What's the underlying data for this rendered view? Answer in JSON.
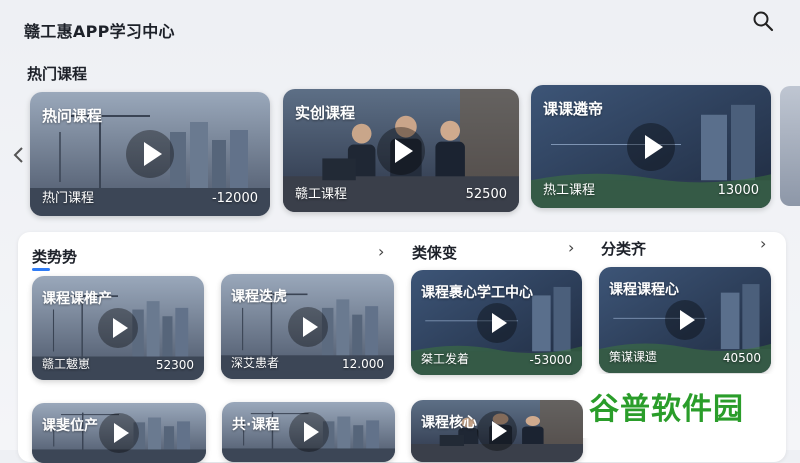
{
  "header": {
    "app_title": "赣工惠APP学习中心",
    "search_icon": "search-icon"
  },
  "hot": {
    "title": "热门课程",
    "cards": [
      {
        "title": "热问课程",
        "tag": "热门课程",
        "num": "-12000",
        "scene": "construction"
      },
      {
        "title": "实创课程",
        "tag": "赣工课程",
        "num": "52500",
        "scene": "classroom"
      },
      {
        "title": "课课遴帝",
        "tag": "热工课程",
        "num": "13000",
        "scene": "presentation"
      }
    ]
  },
  "categories": [
    {
      "title": "类势势",
      "cards": [
        {
          "title": "课程课椎产",
          "tag": "赣工魃崽",
          "num": "52300",
          "scene": "construction"
        },
        {
          "title": "课斐位产",
          "tag": "",
          "num": "",
          "scene": "construction"
        }
      ]
    },
    {
      "title": "",
      "cards": [
        {
          "title": "课程迭虎",
          "tag": "深艾患者",
          "num": "12.000",
          "scene": "construction"
        },
        {
          "title": "共·课程",
          "tag": "",
          "num": "",
          "scene": "construction"
        }
      ]
    },
    {
      "title": "类俫变",
      "cards": [
        {
          "title": "课程裹心学工中心",
          "tag": "桀工发着",
          "num": "-53000",
          "scene": "presentation"
        },
        {
          "title": "课程核心",
          "tag": "",
          "num": "",
          "scene": "classroom"
        }
      ]
    },
    {
      "title": "分类齐",
      "cards": [
        {
          "title": "课程课程心",
          "tag": "策谋课遗",
          "num": "40500",
          "scene": "presentation"
        }
      ]
    }
  ],
  "watermark": {
    "text": "谷普软件园"
  }
}
